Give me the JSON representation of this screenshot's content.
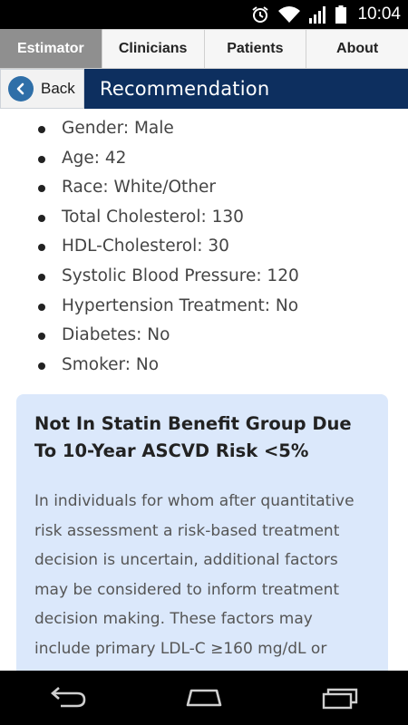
{
  "status_bar": {
    "time": "10:04",
    "icons": [
      "alarm-icon",
      "wifi-icon",
      "signal-icon",
      "battery-icon"
    ]
  },
  "tabs": [
    {
      "label": "Estimator",
      "active": true
    },
    {
      "label": "Clinicians",
      "active": false
    },
    {
      "label": "Patients",
      "active": false
    },
    {
      "label": "About",
      "active": false
    }
  ],
  "header": {
    "back_label": "Back",
    "title": "Recommendation"
  },
  "inputs": [
    "Gender: Male",
    "Age: 42",
    "Race: White/Other",
    "Total Cholesterol: 130",
    "HDL-Cholesterol: 30",
    "Systolic Blood Pressure: 120",
    "Hypertension Treatment: No",
    "Diabetes: No",
    "Smoker: No"
  ],
  "recommendation": {
    "heading": "Not In Statin Benefit Group Due To 10-Year ASCVD Risk <5%",
    "body": "In individuals for whom after quantitative risk assessment a risk-based treatment decision is uncertain, additional factors may be considered to inform treatment decision making. These factors may include primary LDL-C ≥160 mg/dL or"
  },
  "nav_bar": {
    "buttons": [
      "back-nav-icon",
      "home-nav-icon",
      "recents-nav-icon"
    ]
  },
  "colors": {
    "header_bg": "#0d2f5f",
    "active_tab_bg": "#8f8f8f",
    "card_bg": "#dbe8fb",
    "back_circle": "#2f6fa8"
  }
}
